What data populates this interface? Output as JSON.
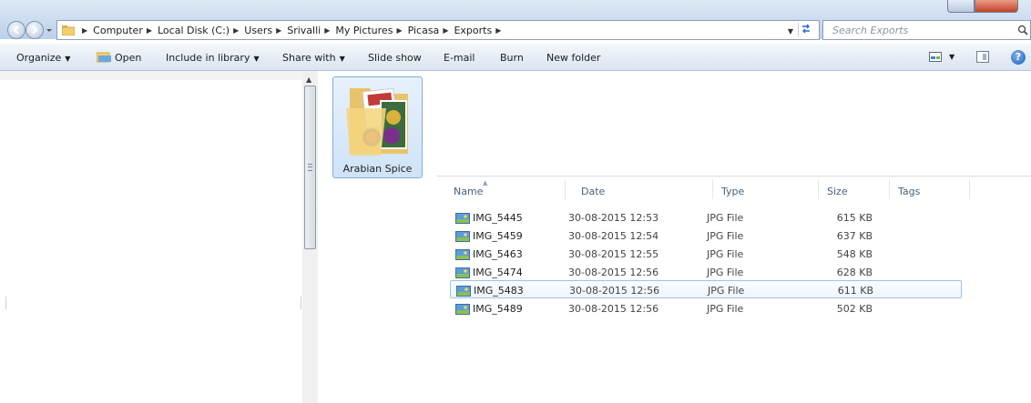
{
  "breadcrumb": [
    "Computer",
    "Local Disk (C:)",
    "Users",
    "Srivalli",
    "My Pictures",
    "Picasa",
    "Exports"
  ],
  "search": {
    "placeholder": "Search Exports"
  },
  "toolbar": {
    "organize": "Organize",
    "open": "Open",
    "include_in_library": "Include in library",
    "share_with": "Share with",
    "slide_show": "Slide show",
    "email": "E-mail",
    "burn": "Burn",
    "new_folder": "New folder"
  },
  "folder": {
    "name": "Arabian Spice"
  },
  "columns": {
    "name": "Name",
    "date": "Date",
    "type": "Type",
    "size": "Size",
    "tags": "Tags"
  },
  "files": [
    {
      "name": "IMG_5445",
      "date": "30-08-2015 12:53",
      "type": "JPG File",
      "size": "615 KB"
    },
    {
      "name": "IMG_5459",
      "date": "30-08-2015 12:54",
      "type": "JPG File",
      "size": "637 KB"
    },
    {
      "name": "IMG_5463",
      "date": "30-08-2015 12:55",
      "type": "JPG File",
      "size": "548 KB"
    },
    {
      "name": "IMG_5474",
      "date": "30-08-2015 12:56",
      "type": "JPG File",
      "size": "628 KB"
    },
    {
      "name": "IMG_5483",
      "date": "30-08-2015 12:56",
      "type": "JPG File",
      "size": "611 KB",
      "selected": true
    },
    {
      "name": "IMG_5489",
      "date": "30-08-2015 12:56",
      "type": "JPG File",
      "size": "502 KB"
    }
  ],
  "icons": {
    "back": "back-arrow-icon",
    "forward": "forward-arrow-icon",
    "folder": "folder-icon",
    "refresh": "refresh-icon",
    "search": "search-icon",
    "open": "open-icon",
    "views": "views-icon",
    "preview_pane": "preview-pane-icon",
    "help": "help-icon",
    "jpg": "jpg-file-icon"
  },
  "colors": {
    "selection_border": "#9fc3e9",
    "column_header": "#4c607a",
    "help_blue": "#1d5fb8"
  }
}
